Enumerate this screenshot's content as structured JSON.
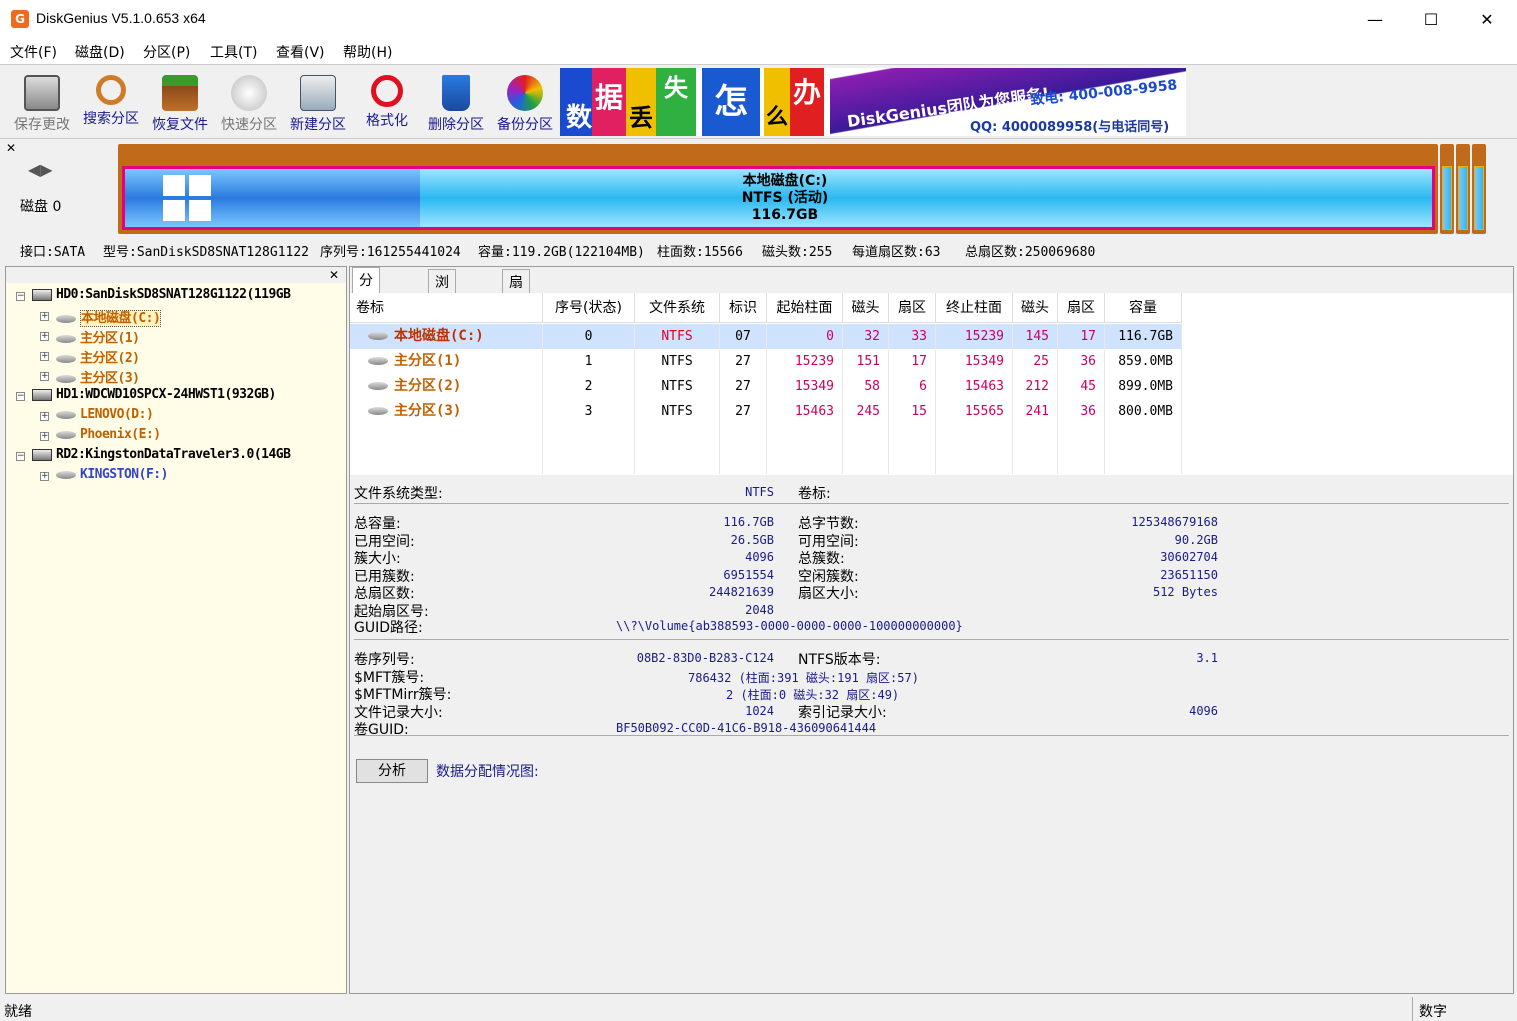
{
  "window": {
    "title": "DiskGenius V5.1.0.653 x64",
    "app_icon": "G"
  },
  "menu": [
    "文件(F)",
    "磁盘(D)",
    "分区(P)",
    "工具(T)",
    "查看(V)",
    "帮助(H)"
  ],
  "toolbar": [
    {
      "label": "保存更改",
      "icon": "save-icon"
    },
    {
      "label": "搜索分区",
      "icon": "search-icon"
    },
    {
      "label": "恢复文件",
      "icon": "restore-icon"
    },
    {
      "label": "快速分区",
      "icon": "quick-partition-icon"
    },
    {
      "label": "新建分区",
      "icon": "new-partition-icon"
    },
    {
      "label": "格式化",
      "icon": "format-icon"
    },
    {
      "label": "删除分区",
      "icon": "delete-icon"
    },
    {
      "label": "备份分区",
      "icon": "backup-icon"
    }
  ],
  "ad": {
    "chars": [
      "数",
      "据",
      "丢",
      "失",
      "怎",
      "么",
      "办",
      "!"
    ],
    "brand": "DiskGenius团队为您服务!",
    "phone": "致电: 400-008-9958",
    "qq": "QQ: 4000089958(与电话同号)"
  },
  "diskmap": {
    "disk_label": "磁盘 0",
    "partition_name": "本地磁盘(C:)",
    "partition_fs": "NTFS (活动)",
    "partition_size": "116.7GB"
  },
  "diskinfo": {
    "interface": "接口:SATA",
    "model": "型号:SanDiskSD8SNAT128G1122",
    "serial": "序列号:161255441024",
    "capacity": "容量:119.2GB(122104MB)",
    "cylinders": "柱面数:15566",
    "heads": "磁头数:255",
    "sectors_per_track": "每道扇区数:63",
    "total_sectors": "总扇区数:250069680"
  },
  "tree": [
    {
      "text": "HD0:SanDiskSD8SNAT128G1122(119GB",
      "type": "disk",
      "color": "#000"
    },
    {
      "text": "本地磁盘(C:)",
      "type": "part",
      "color": "#c06000",
      "selected": true
    },
    {
      "text": "主分区(1)",
      "type": "part",
      "color": "#c06000"
    },
    {
      "text": "主分区(2)",
      "type": "part",
      "color": "#c06000"
    },
    {
      "text": "主分区(3)",
      "type": "part",
      "color": "#c06000"
    },
    {
      "text": "HD1:WDCWD10SPCX-24HWST1(932GB)",
      "type": "disk",
      "color": "#000"
    },
    {
      "text": "LENOVO(D:)",
      "type": "part",
      "color": "#c06000"
    },
    {
      "text": "Phoenix(E:)",
      "type": "part",
      "color": "#c06000"
    },
    {
      "text": "RD2:KingstonDataTraveler3.0(14GB",
      "type": "disk",
      "color": "#000"
    },
    {
      "text": "KINGSTON(F:)",
      "type": "part",
      "color": "#3344cc"
    }
  ],
  "tabs": [
    "分区参数",
    "浏览文件",
    "扇区编辑"
  ],
  "table": {
    "headers": [
      "卷标",
      "序号(状态)",
      "文件系统",
      "标识",
      "起始柱面",
      "磁头",
      "扇区",
      "终止柱面",
      "磁头",
      "扇区",
      "容量"
    ],
    "rows": [
      [
        "本地磁盘(C:)",
        "0",
        "NTFS",
        "07",
        "0",
        "32",
        "33",
        "15239",
        "145",
        "17",
        "116.7GB"
      ],
      [
        "主分区(1)",
        "1",
        "NTFS",
        "27",
        "15239",
        "151",
        "17",
        "15349",
        "25",
        "36",
        "859.0MB"
      ],
      [
        "主分区(2)",
        "2",
        "NTFS",
        "27",
        "15349",
        "58",
        "6",
        "15463",
        "212",
        "45",
        "899.0MB"
      ],
      [
        "主分区(3)",
        "3",
        "NTFS",
        "27",
        "15463",
        "245",
        "15",
        "15565",
        "241",
        "36",
        "800.0MB"
      ]
    ]
  },
  "details": {
    "fs_type_label": "文件系统类型:",
    "fs_type": "NTFS",
    "vol_label": "卷标:",
    "left1": [
      [
        "总容量:",
        "116.7GB"
      ],
      [
        "已用空间:",
        "26.5GB"
      ],
      [
        "簇大小:",
        "4096"
      ],
      [
        "已用簇数:",
        "6951554"
      ],
      [
        "总扇区数:",
        "244821639"
      ],
      [
        "起始扇区号:",
        "2048"
      ]
    ],
    "right1": [
      [
        "总字节数:",
        "125348679168"
      ],
      [
        "可用空间:",
        "90.2GB"
      ],
      [
        "总簇数:",
        "30602704"
      ],
      [
        "空闲簇数:",
        "23651150"
      ],
      [
        "扇区大小:",
        "512 Bytes"
      ]
    ],
    "guid_label": "GUID路径:",
    "guid": "\\\\?\\Volume{ab388593-0000-0000-0000-100000000000}",
    "left2": [
      [
        "卷序列号:",
        "08B2-83D0-B283-C124"
      ],
      [
        "$MFT簇号:",
        "786432 (柱面:391 磁头:191 扇区:57)"
      ],
      [
        "$MFTMirr簇号:",
        "2 (柱面:0 磁头:32 扇区:49)"
      ],
      [
        "文件记录大小:",
        "1024"
      ],
      [
        "卷GUID:",
        "BF50B092-CC0D-41C6-B918-436090641444"
      ]
    ],
    "right2": [
      [
        "NTFS版本号:",
        "3.1"
      ],
      [
        "",
        ""
      ],
      [
        "",
        ""
      ],
      [
        "索引记录大小:",
        "4096"
      ]
    ],
    "analyze": "分析",
    "alloc_map": "数据分配情况图:"
  },
  "status": {
    "left": "就绪",
    "right": "数字"
  }
}
